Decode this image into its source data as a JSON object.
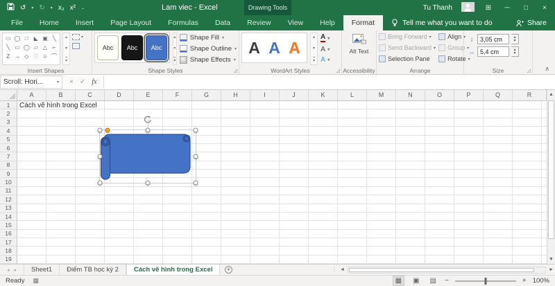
{
  "colors": {
    "accent_green": "#217346",
    "contextual_green": "#17583a",
    "shape_blue": "#4472c4",
    "shape_blue_dark": "#2e5395",
    "wordart_orange": "#ed7d31"
  },
  "titlebar": {
    "title": "Lam viec - Excel",
    "contextual_group": "Drawing Tools",
    "user": "Tu Thanh",
    "qat": {
      "subscript": "x₂",
      "superscript": "x²"
    }
  },
  "tabs": {
    "items": [
      "File",
      "Home",
      "Insert",
      "Page Layout",
      "Formulas",
      "Data",
      "Review",
      "View",
      "Help"
    ],
    "active": "Format",
    "tell_me": "Tell me what you want to do",
    "share": "Share"
  },
  "ribbon": {
    "insert_shapes": {
      "label": "Insert Shapes",
      "icons": [
        "▭",
        "◯",
        "□",
        "◣",
        "▣",
        "╲",
        "╲",
        "▭",
        "◯",
        "▱",
        "△",
        "⌐",
        "Z",
        "→",
        "◇",
        "♡",
        "☺",
        "⌒"
      ]
    },
    "shape_styles": {
      "label": "Shape Styles",
      "tiles": [
        {
          "text": "Abc",
          "variant": "outline"
        },
        {
          "text": "Abc",
          "variant": "black"
        },
        {
          "text": "Abc",
          "variant": "blue",
          "selected": true
        }
      ],
      "buttons": [
        "Shape Fill",
        "Shape Outline",
        "Shape Effects"
      ]
    },
    "wordart": {
      "label": "WordArt Styles",
      "letters": [
        {
          "ch": "A",
          "variant": "black"
        },
        {
          "ch": "A",
          "variant": "blue"
        },
        {
          "ch": "A",
          "variant": "orange"
        }
      ],
      "side_buttons": [
        {
          "ch": "A",
          "name": "text-fill"
        },
        {
          "ch": "A",
          "name": "text-outline"
        },
        {
          "ch": "A",
          "name": "text-effects"
        }
      ]
    },
    "accessibility": {
      "label": "Accessibility",
      "alt_text": "Alt Text"
    },
    "arrange": {
      "label": "Arrange",
      "col1": [
        {
          "label": "Bring Forward",
          "disabled": true,
          "caret": true
        },
        {
          "label": "Send Backward",
          "disabled": true,
          "caret": true
        },
        {
          "label": "Selection Pane"
        }
      ],
      "col2": [
        {
          "label": "Align",
          "caret": true
        },
        {
          "label": "Group",
          "disabled": true,
          "caret": true
        },
        {
          "label": "Rotate",
          "caret": true
        }
      ]
    },
    "size": {
      "label": "Size",
      "height": "3,05 cm",
      "width": "5,4 cm"
    }
  },
  "formula_bar": {
    "name_box": "Scroll: Hori...",
    "fx_label": "fx",
    "formula_value": ""
  },
  "grid": {
    "columns": [
      "A",
      "B",
      "C",
      "D",
      "E",
      "F",
      "G",
      "H",
      "I",
      "J",
      "K",
      "L",
      "M",
      "N",
      "O",
      "P",
      "Q",
      "R"
    ],
    "rows": [
      "1",
      "2",
      "3",
      "4",
      "5",
      "6",
      "7",
      "8",
      "9",
      "10",
      "11",
      "12",
      "13",
      "14",
      "15",
      "16",
      "17",
      "18",
      "19"
    ],
    "a1_text": "Cách vẽ hình trong Excel"
  },
  "sheet_bar": {
    "tabs": [
      {
        "label": "Sheet1"
      },
      {
        "label": "Điểm TB học kỳ 2"
      },
      {
        "label": "Cách vẽ hình trong Excel",
        "active": true
      }
    ],
    "new_sheet": "+"
  },
  "status_bar": {
    "mode": "Ready",
    "zoom_level": "100%"
  }
}
